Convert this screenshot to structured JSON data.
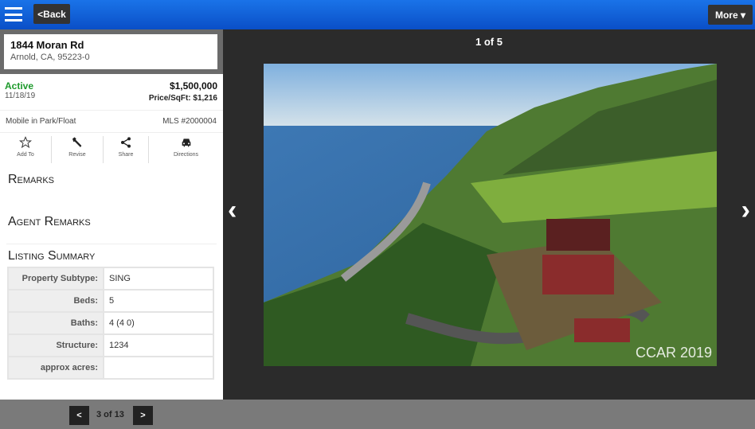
{
  "header": {
    "back_label": "<Back",
    "more_label": "More ▾"
  },
  "listing": {
    "address": "1844 Moran Rd",
    "city": "Arnold, CA, 95223-0",
    "status": "Active",
    "status_color": "#1e9a2c",
    "date": "11/18/19",
    "price": "$1,500,000",
    "price_sqft": "Price/SqFt: $1,216",
    "type": "Mobile in Park/Float",
    "mls": "MLS #2000004"
  },
  "actions": [
    {
      "label": "Add To",
      "icon": "star-icon"
    },
    {
      "label": "Revise",
      "icon": "wrench-icon"
    },
    {
      "label": "Share",
      "icon": "share-icon"
    },
    {
      "label": "Directions",
      "icon": "car-icon"
    }
  ],
  "sections": {
    "remarks": "Remarks",
    "agent_remarks": "Agent Remarks",
    "listing_summary": "Listing Summary"
  },
  "summary": [
    {
      "k": "Property Subtype:",
      "v": "SING"
    },
    {
      "k": "Beds:",
      "v": "5"
    },
    {
      "k": "Baths:",
      "v": "4 (4 0)"
    },
    {
      "k": "Structure:",
      "v": "1234"
    },
    {
      "k": "approx acres:",
      "v": ""
    }
  ],
  "viewer": {
    "counter": "1 of 5",
    "watermark": "CCAR 2019"
  },
  "pager": {
    "prev": "<",
    "text": "3 of 13",
    "next": ">"
  }
}
